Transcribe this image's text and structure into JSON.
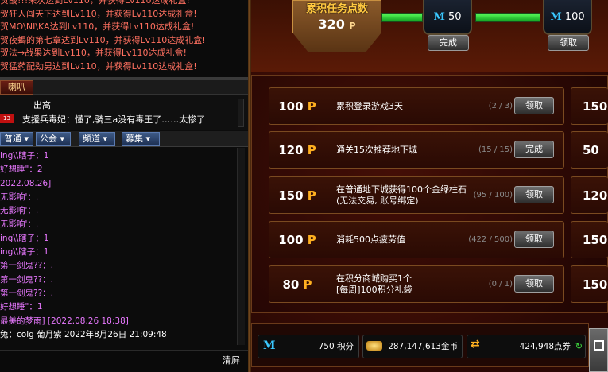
{
  "broadcast": [
    "贺战!!!来次达到Lv110，并获得Lv110达成礼盒!",
    "贺狂人闯天下达到Lv110，并获得Lv110达成礼盒!",
    "贺MO\\NI\\KA达到Lv110，并获得Lv110达成礼盒!",
    "贺夜蝎的第七章达到Lv110，并获得Lv110达成礼盒!",
    "贺法→战果达到Lv110，并获得Lv110达成礼盒!",
    "贺猛药配劲男达到Lv110，并获得Lv110达成礼盒!"
  ],
  "horn": {
    "tab": "喇叭",
    "name": "出高",
    "badge": "13",
    "message": "支援兵毒妃：懂了,骑三a没有毒王了……太惨了"
  },
  "chat_tabs": [
    {
      "label": "普通 ▾"
    },
    {
      "label": "公会 ▾"
    },
    {
      "label": "频道 ▾"
    },
    {
      "label": "募集 ▾"
    }
  ],
  "chat_lines": [
    {
      "text": "ing\\\\瞎子：1",
      "color": "#e878ff"
    },
    {
      "text": "好想睡\"：2",
      "color": "#e878ff"
    },
    {
      "text": "2022.08.26]",
      "color": "#e878ff"
    },
    {
      "text": "无影响'：.",
      "color": "#e878ff"
    },
    {
      "text": "无影响'：.",
      "color": "#e878ff"
    },
    {
      "text": "无影响'：.",
      "color": "#e878ff"
    },
    {
      "text": "ing\\\\瞎子：1",
      "color": "#e878ff"
    },
    {
      "text": "ing\\\\瞎子：1",
      "color": "#e878ff"
    },
    {
      "text": "第一剑鬼??：.",
      "color": "#e878ff"
    },
    {
      "text": "第一剑鬼??：.",
      "color": "#e878ff"
    },
    {
      "text": "第一剑鬼??：.",
      "color": "#e878ff"
    },
    {
      "text": "好想睡\"：1",
      "color": "#e878ff"
    },
    {
      "text": "最美的梦雨] [2022.08.26 18:38]",
      "color": "#e878ff"
    },
    {
      "text": "兔：colg  葡月紫 2022年8月26日 21:09:48",
      "color": "#ffffff"
    }
  ],
  "clear_label": "清屏",
  "banner": {
    "title": "累积任务点数",
    "value": "320",
    "unit": "P"
  },
  "milestones": [
    {
      "value": "50",
      "button": "完成",
      "progress": 1.0
    },
    {
      "value": "100",
      "button": "领取",
      "progress": 1.0
    }
  ],
  "tasks": [
    {
      "points": "100",
      "desc1": "累积登录游戏3天",
      "desc2": "",
      "count": "(2 / 3)",
      "button": "领取"
    },
    {
      "points": "120",
      "desc1": "通关15次推荐地下城",
      "desc2": "",
      "count": "(15 / 15)",
      "button": "完成"
    },
    {
      "points": "150",
      "desc1": "在普通地下城获得100个金绿柱石",
      "desc2": "(无法交易, 账号绑定)",
      "count": "(95 / 100)",
      "button": "领取"
    },
    {
      "points": "100",
      "desc1": "消耗500点疲劳值",
      "desc2": "",
      "count": "(422 / 500)",
      "button": "领取"
    },
    {
      "points": "80",
      "desc1": "在积分商城购买1个",
      "desc2": "[每周]100积分礼袋",
      "count": "(0 / 1)",
      "button": "领取"
    }
  ],
  "right_col_points": [
    "150",
    "50",
    "120",
    "150",
    "150"
  ],
  "point_unit": "P",
  "currency": {
    "points": "750 积分",
    "gold": "287,147,613金币",
    "cera": "424,948点券"
  },
  "colors": {
    "accent_gold": "#ffb020",
    "badge_blue": "#3ac8ff",
    "broadcast_red": "#ff7060"
  }
}
